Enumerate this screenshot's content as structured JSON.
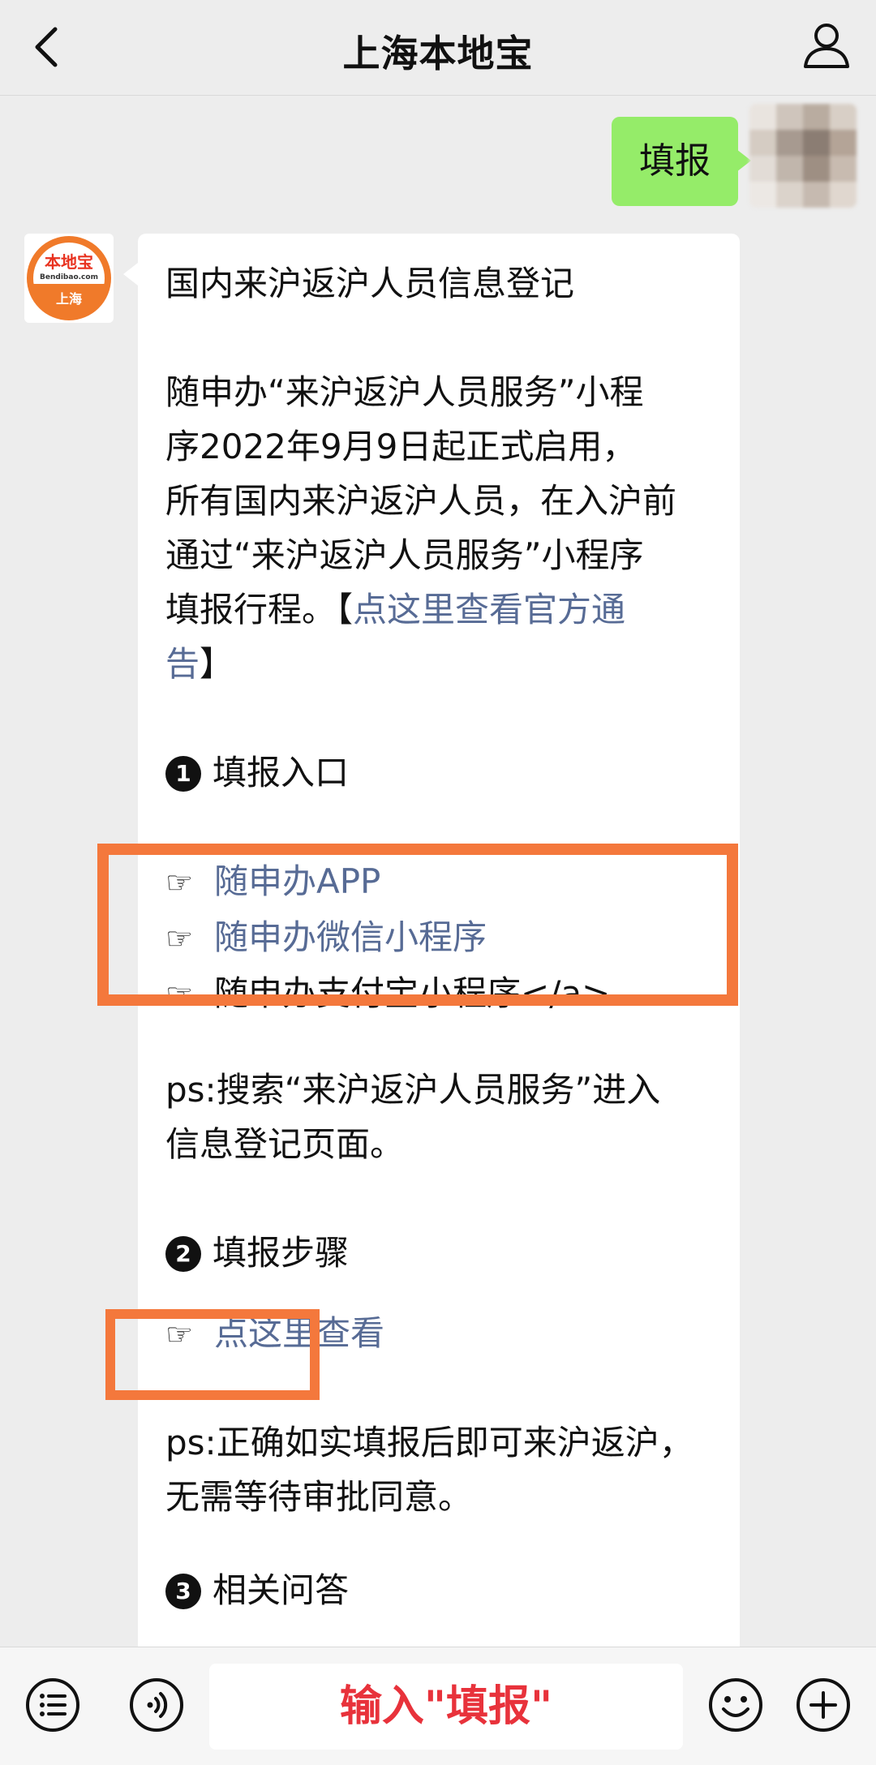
{
  "header": {
    "title": "上海本地宝"
  },
  "sent": {
    "text": "填报"
  },
  "account_avatar": {
    "brand": "本地宝",
    "domain": "Bendibao.com",
    "city": "上海"
  },
  "message": {
    "title": "国内来沪返沪人员信息登记",
    "intro_lines": [
      "随申办“来沪返沪人员服务”小程",
      "序2022年9月9日起正式启用，",
      "所有国内来沪返沪人员，在入沪前",
      "通过“来沪返沪人员服务”小程序"
    ],
    "intro_tail": "填报行程。【",
    "intro_link_1": "点这里查看官方通",
    "intro_link_2": "告",
    "intro_close": "】",
    "section1_badge": "1",
    "section1_title": "填报入口",
    "pointer_glyph": "☞",
    "entries": [
      {
        "label": "随申办APP"
      },
      {
        "label": "随申办微信小程序"
      },
      {
        "label": "随申办支付宝小程序</a>"
      }
    ],
    "ps1_line1": "ps:搜索“来沪返沪人员服务”进入",
    "ps1_line2": "信息登记页面。",
    "section2_badge": "2",
    "section2_title": "填报步骤",
    "steps_link": "点这里查看",
    "ps2_line1": "ps:正确如实填报后即可来沪返沪，",
    "ps2_line2": "无需等待审批同意。",
    "section3_badge": "3",
    "section3_title": "相关问答"
  },
  "input": {
    "hint": "输入\"填报\""
  },
  "colors": {
    "link": "#576b95",
    "highlight_frame": "#f4783c",
    "sent_bubble": "#95ec69",
    "input_hint": "#e8323b"
  },
  "icons": {
    "back": "chevron-left-icon",
    "profile": "user-icon",
    "menu": "list-menu-icon",
    "voice": "voice-icon",
    "emoji": "emoji-icon",
    "more": "plus-icon"
  }
}
